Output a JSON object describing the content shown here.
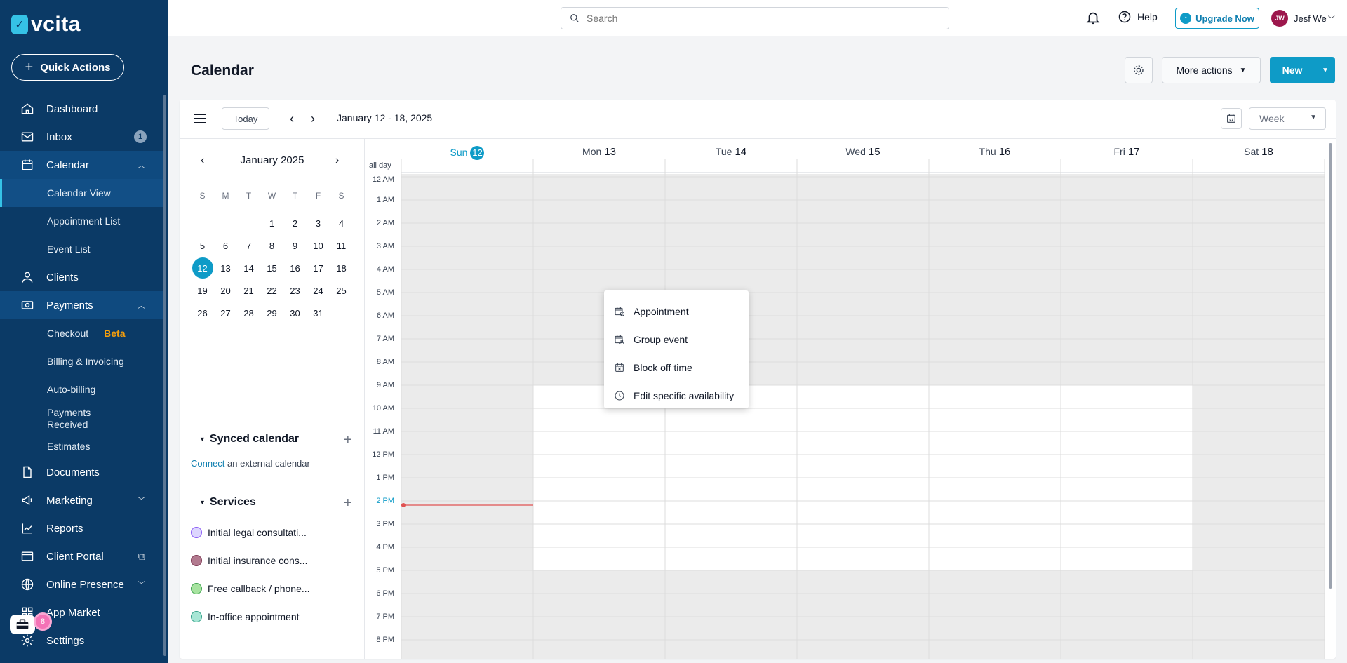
{
  "app": {
    "logo_text": "vcita",
    "quick_actions_label": "Quick Actions"
  },
  "sidebar": {
    "items": [
      {
        "label": "Dashboard",
        "icon": "home-icon"
      },
      {
        "label": "Inbox",
        "icon": "mail-icon",
        "badge": "1"
      },
      {
        "label": "Calendar",
        "icon": "calendar-icon",
        "expanded": true
      },
      {
        "label": "Calendar View",
        "sub": true,
        "selected": true
      },
      {
        "label": "Appointment List",
        "sub": true
      },
      {
        "label": "Event List",
        "sub": true
      },
      {
        "label": "Clients",
        "icon": "user-icon"
      },
      {
        "label": "Payments",
        "icon": "payments-icon",
        "expanded": true
      },
      {
        "label": "Checkout",
        "sub": true,
        "tag": "Beta"
      },
      {
        "label": "Billing & Invoicing",
        "sub": true
      },
      {
        "label": "Auto-billing",
        "sub": true
      },
      {
        "label": "Payments Received",
        "sub": true
      },
      {
        "label": "Estimates",
        "sub": true
      },
      {
        "label": "Documents",
        "icon": "document-icon"
      },
      {
        "label": "Marketing",
        "icon": "megaphone-icon",
        "collapsed": true
      },
      {
        "label": "Reports",
        "icon": "chart-icon"
      },
      {
        "label": "Client Portal",
        "icon": "portal-icon",
        "external": true
      },
      {
        "label": "Online Presence",
        "icon": "globe-icon",
        "collapsed": true
      },
      {
        "label": "App Market",
        "icon": "apps-icon"
      },
      {
        "label": "Settings",
        "icon": "gear-icon"
      }
    ],
    "toolbox_badge": "8"
  },
  "header": {
    "search_placeholder": "Search",
    "help_label": "Help",
    "upgrade_label": "Upgrade Now",
    "user_initials": "JW",
    "user_name": "Jesf We"
  },
  "page": {
    "title": "Calendar",
    "more_actions_label": "More actions",
    "new_label": "New"
  },
  "calendar": {
    "today_label": "Today",
    "range_label": "January 12 - 18, 2025",
    "view_label": "Week",
    "mini": {
      "month_label": "January 2025",
      "weekdays": [
        "S",
        "M",
        "T",
        "W",
        "T",
        "F",
        "S"
      ],
      "weeks": [
        [
          "",
          "",
          "",
          "1",
          "2",
          "3",
          "4"
        ],
        [
          "5",
          "6",
          "7",
          "8",
          "9",
          "10",
          "11"
        ],
        [
          "12",
          "13",
          "14",
          "15",
          "16",
          "17",
          "18"
        ],
        [
          "19",
          "20",
          "21",
          "22",
          "23",
          "24",
          "25"
        ],
        [
          "26",
          "27",
          "28",
          "29",
          "30",
          "31",
          ""
        ]
      ],
      "today": "12"
    },
    "synced_title": "Synced calendar",
    "connect_link": "Connect",
    "connect_rest": " an external calendar",
    "services_title": "Services",
    "services": [
      {
        "label": "Initial legal consultati...",
        "fill": "#ddd6fe",
        "border": "#8b5cf6"
      },
      {
        "label": "Initial insurance cons...",
        "fill": "#b27a8f",
        "border": "#7f3a55"
      },
      {
        "label": "Free callback / phone...",
        "fill": "#a7e3a0",
        "border": "#3fa34d"
      },
      {
        "label": "In-office appointment",
        "fill": "#a7e6d5",
        "border": "#2f9e86"
      }
    ],
    "all_day_label": "all day",
    "days": [
      {
        "name": "Sun",
        "num": "12",
        "current": true
      },
      {
        "name": "Mon",
        "num": "13"
      },
      {
        "name": "Tue",
        "num": "14"
      },
      {
        "name": "Wed",
        "num": "15"
      },
      {
        "name": "Thu",
        "num": "16"
      },
      {
        "name": "Fri",
        "num": "17"
      },
      {
        "name": "Sat",
        "num": "18"
      }
    ],
    "hours": [
      "12 AM",
      "1 AM",
      "2 AM",
      "3 AM",
      "4 AM",
      "5 AM",
      "6 AM",
      "7 AM",
      "8 AM",
      "9 AM",
      "10 AM",
      "11 AM",
      "12 PM",
      "1 PM",
      "2 PM",
      "3 PM",
      "4 PM",
      "5 PM",
      "6 PM",
      "7 PM",
      "8 PM"
    ],
    "current_hour_label": "2 PM"
  },
  "context_menu": {
    "items": [
      {
        "label": "Appointment",
        "icon": "appointment-icon"
      },
      {
        "label": "Group event",
        "icon": "group-event-icon"
      },
      {
        "label": "Block off time",
        "icon": "block-time-icon"
      },
      {
        "label": "Edit specific availability",
        "icon": "clock-icon"
      }
    ]
  },
  "colors": {
    "sidebar": "#0b3a66",
    "accent": "#0e9bc7",
    "now_line": "#e05252",
    "unavailable": "#ebebeb"
  }
}
